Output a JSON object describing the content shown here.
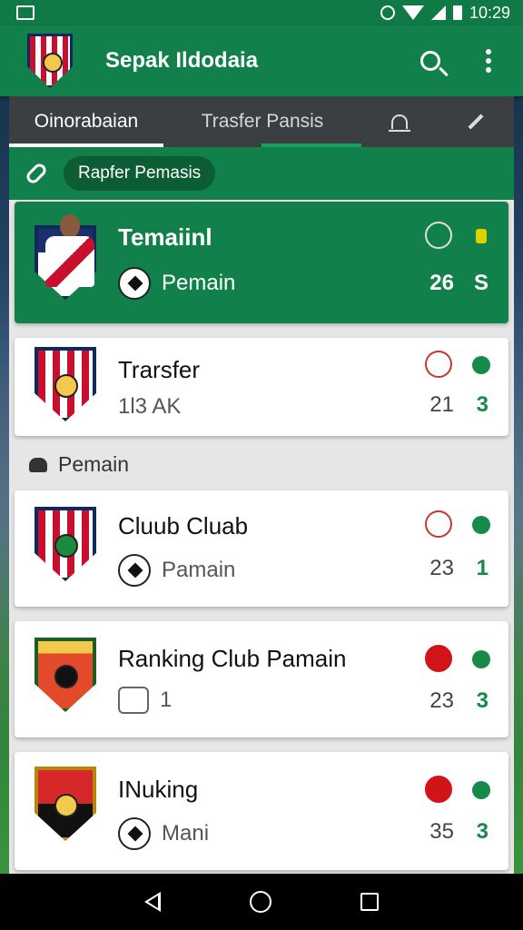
{
  "status": {
    "time": "10:29"
  },
  "appbar": {
    "title": "Sepak Ildodaia"
  },
  "tabs": [
    {
      "label": "Oinorabaian"
    },
    {
      "label": "Trasfer Pansis"
    }
  ],
  "chip": {
    "label": "Rapfer Pemasis"
  },
  "cards": [
    {
      "title": "Temaiinl",
      "sub": "Pemain",
      "num1": "26",
      "num2": "S"
    },
    {
      "title": "Trarsfer",
      "sub": "1l3 AK",
      "num1": "21",
      "num2": "3"
    },
    {
      "title": "Cluub Cluab",
      "sub": "Pamain",
      "num1": "23",
      "num2": "1"
    },
    {
      "title": "Ranking Club Pamain",
      "sub": "1",
      "num1": "23",
      "num2": "3"
    },
    {
      "title": "INuking",
      "sub": "Mani",
      "num1": "35",
      "num2": "3"
    }
  ],
  "section": {
    "label": "Pemain"
  },
  "colors": {
    "primary": "#12804a",
    "accent": "#168a48",
    "alert": "#d0141a"
  }
}
